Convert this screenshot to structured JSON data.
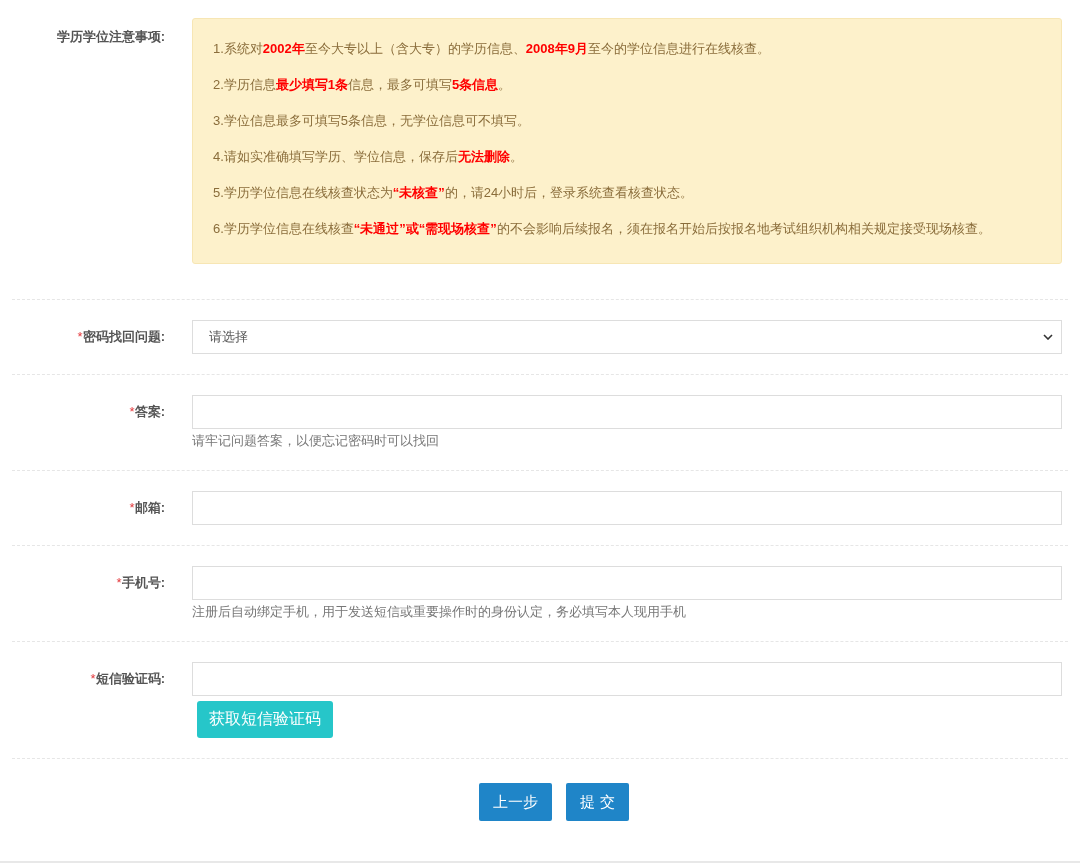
{
  "notice": {
    "label": "学历学位注意事项:",
    "items": [
      "1.系统对**2002年**至今大专以上（含大专）的学历信息、**2008年9月**至今的学位信息进行在线核查。",
      "2.学历信息**最少填写1条**信息，最多可填写**5条信息**。",
      "3.学位信息最多可填写5条信息，无学位信息可不填写。",
      "4.请如实准确填写学历、学位信息，保存后**无法删除**。",
      "5.学历学位信息在线核查状态为**“未核查”**的，请24小时后，登录系统查看核查状态。",
      "6.学历学位信息在线核查**“未通过”或“需现场核查”**的不会影响后续报名，须在报名开始后按报名地考试组织机构相关规定接受现场核查。"
    ]
  },
  "fields": [
    {
      "kind": "select",
      "mark": "*",
      "label": "密码找回问题:",
      "value": "请选择"
    },
    {
      "kind": "text",
      "mark": "*",
      "label": "答案:",
      "hint": "请牢记问题答案，以便忘记密码时可以找回"
    },
    {
      "kind": "text",
      "mark": "*",
      "label": "邮箱:"
    },
    {
      "kind": "text",
      "mark": "*",
      "label": "手机号:",
      "hint": "注册后自动绑定手机，用于发送短信或重要操作时的身份认定，务必填写本人现用手机"
    },
    {
      "kind": "text",
      "mark": "*",
      "label": "短信验证码:",
      "button": "获取短信验证码"
    }
  ],
  "buttons": [
    "上一步",
    "提 交"
  ]
}
